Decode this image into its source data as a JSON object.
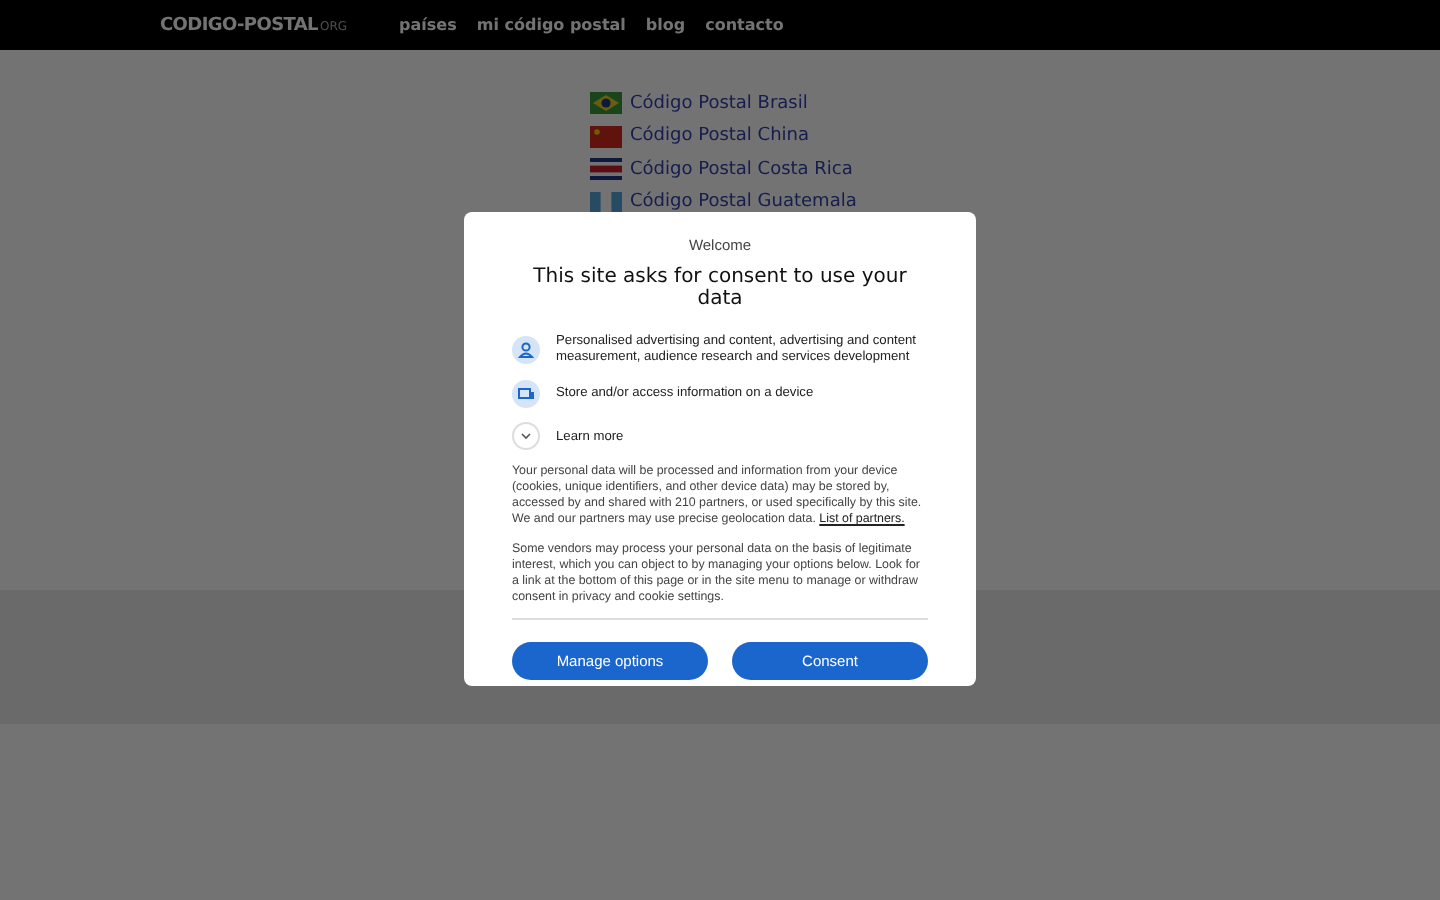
{
  "header": {
    "logo": "CODIGO-POSTAL",
    "logo_suffix": "ORG",
    "nav": [
      "países",
      "mi código postal",
      "blog",
      "contacto"
    ]
  },
  "countries": [
    "Código Postal Brasil",
    "Código Postal China",
    "Código Postal Costa Rica",
    "Código Postal Guatemala"
  ],
  "dialog": {
    "eyebrow": "Welcome",
    "title": "This site asks for consent to use your data",
    "purposes": [
      "Personalised advertising and content, advertising and content measurement, audience research and services development",
      "Store and/or access information on a device"
    ],
    "learn_more": "Learn more",
    "paragraph_1": "Your personal data will be processed and information from your device (cookies, unique identifiers, and other device data) may be stored by, accessed by and shared with 210 partners, or used specifically by this site. We and our partners may use precise geolocation data.",
    "partners_link": "List of partners.",
    "paragraph_2": "Some vendors may process your personal data on the basis of legitimate interest, which you can object to by managing your options below. Look for a link at the bottom of this page or in the site menu to manage or withdraw consent in privacy and cookie settings.",
    "buttons": [
      "Manage options",
      "Consent"
    ]
  }
}
